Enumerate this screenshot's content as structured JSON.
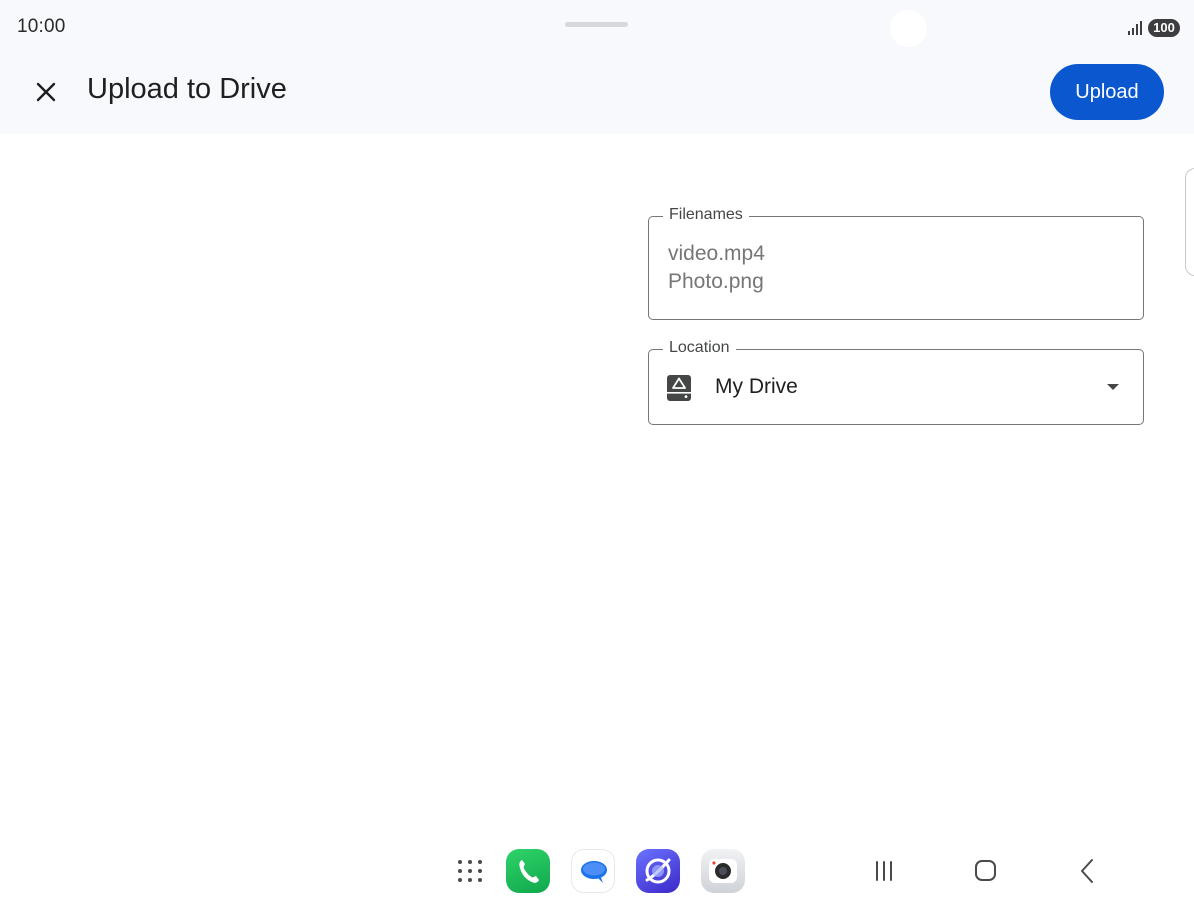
{
  "status_bar": {
    "time": "10:00",
    "battery": "100",
    "icons": [
      "signal-icon",
      "battery-icon"
    ]
  },
  "app_bar": {
    "close_icon": "close-icon",
    "title": "Upload to Drive",
    "upload_label": "Upload"
  },
  "form": {
    "filenames": {
      "label": "Filenames",
      "items": [
        "video.mp4",
        "Photo.png"
      ]
    },
    "location": {
      "label": "Location",
      "value": "My Drive",
      "icon": "my-drive-icon"
    }
  },
  "dock": {
    "apps": [
      "apps-grid-icon",
      "phone-icon",
      "messages-icon",
      "internet-icon",
      "camera-icon"
    ]
  },
  "nav": {
    "buttons": [
      "recents-icon",
      "home-icon",
      "back-icon"
    ]
  },
  "colors": {
    "accent": "#0b57d0",
    "app_bar_bg": "#f8f9fd",
    "outline": "#747775"
  }
}
